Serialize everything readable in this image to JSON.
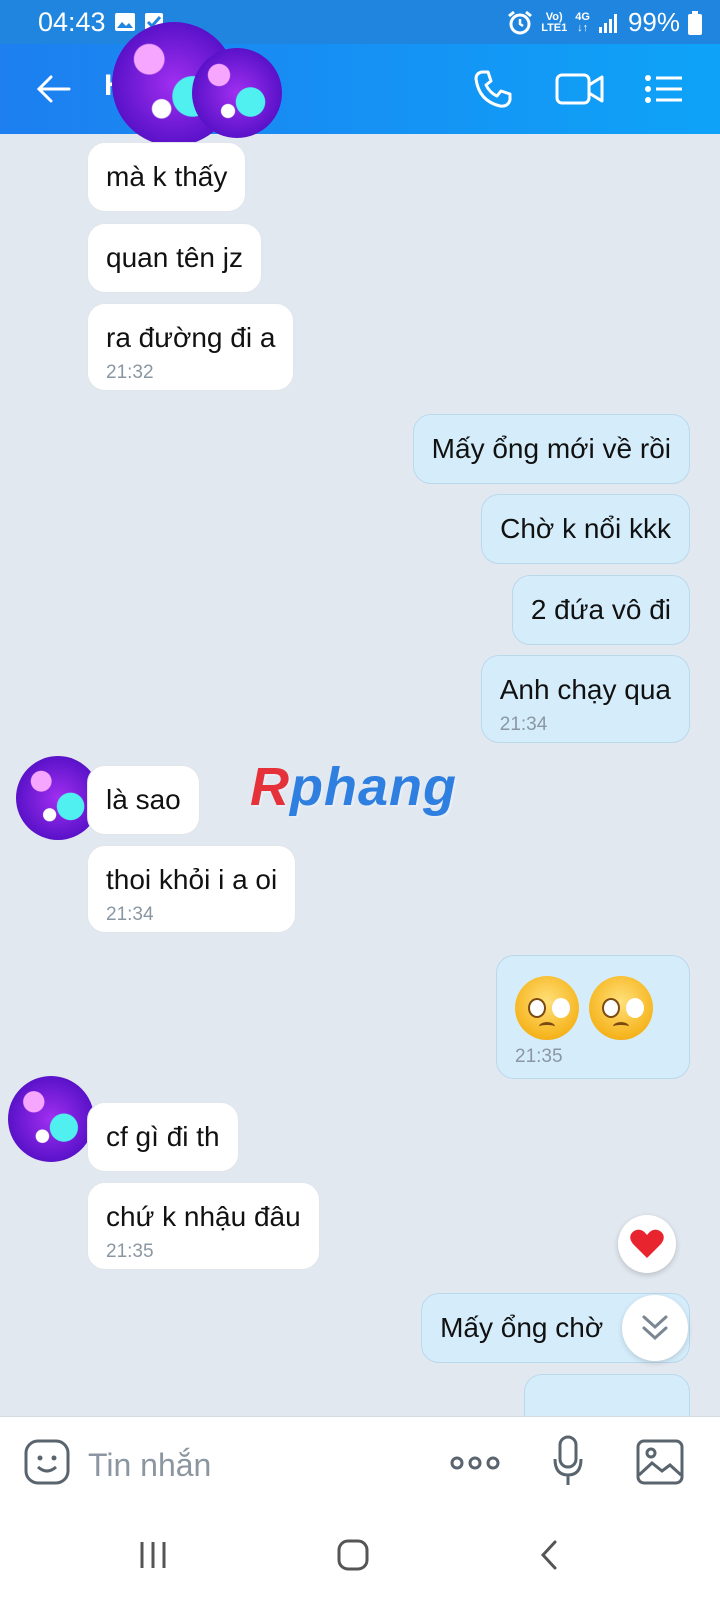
{
  "status": {
    "time": "04:43",
    "net1": "Vo)",
    "net2": "LTE1",
    "net3": "4G",
    "battery": "99%"
  },
  "header": {
    "contact_initial": "H"
  },
  "messages": [
    {
      "side": "in",
      "text": "mà k thấy"
    },
    {
      "side": "in",
      "text": "quan tên jz"
    },
    {
      "side": "in",
      "text": "ra đường đi a",
      "time": "21:32"
    },
    {
      "side": "out",
      "text": "Mấy ổng mới về rồi"
    },
    {
      "side": "out",
      "text": "Chờ k nổi kkk"
    },
    {
      "side": "out",
      "text": "2 đứa vô đi"
    },
    {
      "side": "out",
      "text": "Anh chạy qua",
      "time": "21:34"
    },
    {
      "side": "in",
      "text": "là sao"
    },
    {
      "side": "in",
      "text": "thoi khỏi i a oi",
      "time": "21:34"
    },
    {
      "side": "out",
      "emojis": [
        "pleading-face",
        "pleading-face"
      ],
      "time": "21:35"
    },
    {
      "side": "in",
      "text": "cf gì đi th"
    },
    {
      "side": "in",
      "text": "chứ k nhậu đâu",
      "time": "21:35"
    },
    {
      "side": "out",
      "text": "Mấy ổng chờ"
    }
  ],
  "watermark": {
    "first": "R",
    "rest": "phang"
  },
  "input": {
    "placeholder": "Tin nhắn"
  },
  "colors": {
    "header_start": "#1d7ff0",
    "header_end": "#0ea3f8",
    "out_bubble": "#d5edfb",
    "in_bubble": "#ffffff",
    "chat_bg": "#e2e8f0"
  },
  "icons": [
    "back-arrow-icon",
    "phone-icon",
    "video-icon",
    "list-icon",
    "sticker-icon",
    "more-icon",
    "mic-icon",
    "image-icon",
    "heart-icon",
    "chevron-double-down-icon",
    "recent-apps-icon",
    "home-icon",
    "back-icon"
  ]
}
